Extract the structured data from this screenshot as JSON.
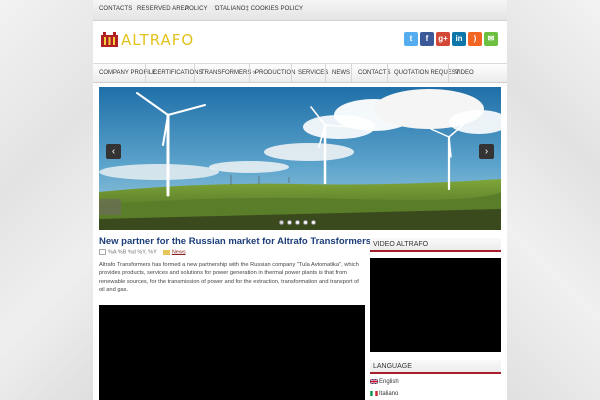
{
  "topbar": {
    "links": [
      "CONTACTS",
      "RESERVED AREA",
      "POLICY",
      "ΏTALIANO‡ COOKIES POLICY"
    ]
  },
  "logo": {
    "text": "ALTRAFO"
  },
  "social": [
    {
      "name": "twitter-icon",
      "glyph": "t",
      "color": "#55acee"
    },
    {
      "name": "facebook-icon",
      "glyph": "f",
      "color": "#3b5998"
    },
    {
      "name": "google-plus-icon",
      "glyph": "g+",
      "color": "#d34836"
    },
    {
      "name": "linkedin-icon",
      "glyph": "in",
      "color": "#0e76a8"
    },
    {
      "name": "rss-icon",
      "glyph": ")",
      "color": "#f26522"
    },
    {
      "name": "email-icon",
      "glyph": "✉",
      "color": "#6cbf3f"
    }
  ],
  "nav": {
    "items": [
      "COMPANY PROFILE",
      "CERTIFICATIONS",
      "TRANSFORMERS »",
      "PRODUCTION",
      "SERVICES",
      "NEWS",
      "CONTACTS",
      "QUOTATION REQUEST",
      "VIDEO"
    ]
  },
  "slider": {
    "prev_label": "‹",
    "next_label": "›",
    "slide_count": 5,
    "active_slide": 1
  },
  "post": {
    "title": "New partner for the Russian market for Altrafo Transformers",
    "date": "%A %B %d %Y, %Y",
    "category": "News",
    "excerpt": "Altrafo Transformers has formed a new partnership with the Russian company \"Tula Avtomatika\", which provides products, services and solutions for power generation in thermal power plants is that from renewable sources, for the transmission of power and for the extraction, transformation and transport of oil and gas."
  },
  "sidebar": {
    "video_heading": "VIDEO ALTRAFO",
    "language_heading": "LANGUAGE",
    "languages": [
      "English",
      "Italiano"
    ]
  }
}
